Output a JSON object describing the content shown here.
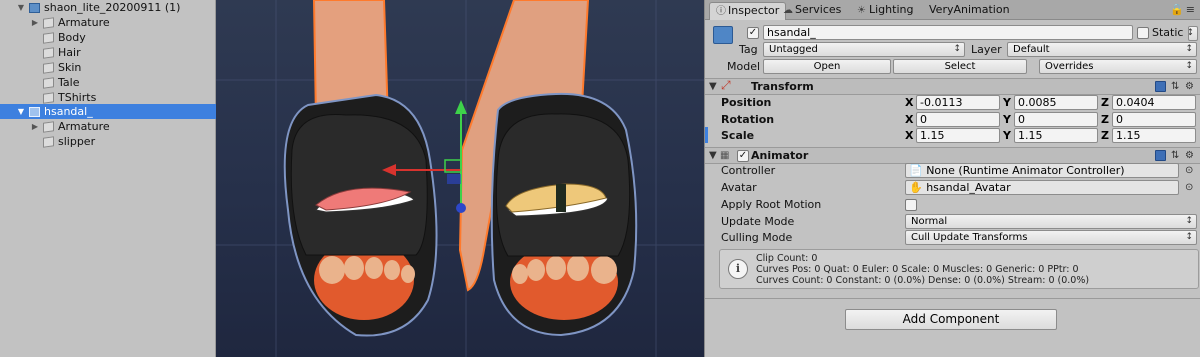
{
  "hierarchy": {
    "items": [
      {
        "label": "shaon_lite_20200911 (1)",
        "icon": "prefab-icon",
        "expanded": true
      },
      {
        "label": "Armature",
        "icon": "gameobject-icon",
        "expanded": false
      },
      {
        "label": "Body",
        "icon": "gameobject-icon"
      },
      {
        "label": "Hair",
        "icon": "gameobject-icon"
      },
      {
        "label": "Skin",
        "icon": "gameobject-icon"
      },
      {
        "label": "Tale",
        "icon": "gameobject-icon"
      },
      {
        "label": "TShirts",
        "icon": "gameobject-icon"
      },
      {
        "label": "hsandal_",
        "icon": "prefab-icon",
        "expanded": true,
        "selected": true
      },
      {
        "label": "Armature",
        "icon": "gameobject-icon",
        "expanded": false
      },
      {
        "label": "slipper",
        "icon": "gameobject-icon"
      }
    ]
  },
  "tabs": [
    {
      "label": "Inspector",
      "icon": "info-icon",
      "active": true
    },
    {
      "label": "Services",
      "icon": "cloud-icon"
    },
    {
      "label": "Lighting",
      "icon": "light-icon"
    },
    {
      "label": "VeryAnimation",
      "icon": ""
    }
  ],
  "header": {
    "object_name": "hsandal_",
    "static_label": "Static",
    "tag_label": "Tag",
    "tag_value": "Untagged",
    "layer_label": "Layer",
    "layer_value": "Default",
    "model_label": "Model",
    "open_label": "Open",
    "select_label": "Select",
    "overrides_label": "Overrides"
  },
  "transform": {
    "title": "Transform",
    "position_label": "Position",
    "rotation_label": "Rotation",
    "scale_label": "Scale",
    "axes": [
      "X",
      "Y",
      "Z"
    ],
    "position": [
      "-0.0113",
      "0.0085",
      "0.0404"
    ],
    "rotation": [
      "0",
      "0",
      "0"
    ],
    "scale": [
      "1.15",
      "1.15",
      "1.15"
    ]
  },
  "animator": {
    "title": "Animator",
    "controller_label": "Controller",
    "controller_value": "None (Runtime Animator Controller)",
    "avatar_label": "Avatar",
    "avatar_value": "hsandal_Avatar",
    "apply_root_motion_label": "Apply Root Motion",
    "update_mode_label": "Update Mode",
    "update_mode_value": "Normal",
    "culling_mode_label": "Culling Mode",
    "culling_mode_value": "Cull Update Transforms",
    "info_lines": [
      "Clip Count: 0",
      "Curves Pos: 0 Quat: 0 Euler: 0 Scale: 0 Muscles: 0 Generic: 0 PPtr: 0",
      "Curves Count: 0 Constant: 0 (0.0%) Dense: 0 (0.0%) Stream: 0 (0.0%)"
    ]
  },
  "add_component_label": "Add Component",
  "colors": {
    "selection": "#3d80df",
    "scene_background": "#2a3450",
    "panel_background": "#c2c2c2"
  }
}
